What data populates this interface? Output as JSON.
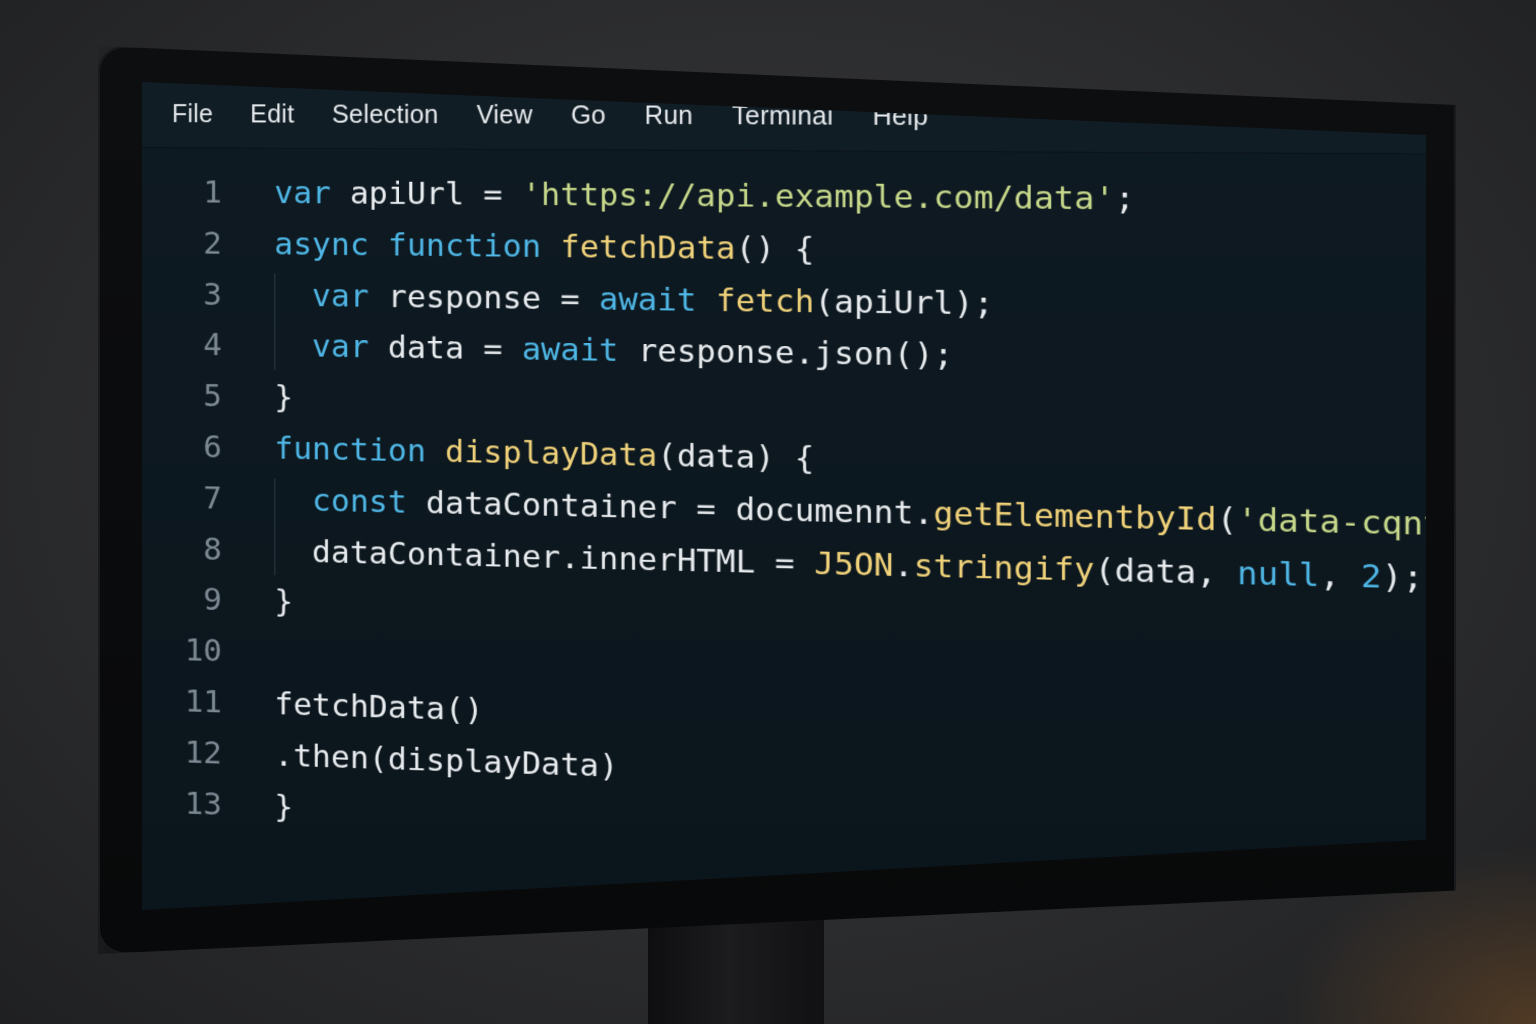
{
  "menu": {
    "items": [
      "File",
      "Edit",
      "Selection",
      "View",
      "Go",
      "Run",
      "Terminal",
      "Help"
    ]
  },
  "editor": {
    "line_numbers": [
      "1",
      "2",
      "3",
      "4",
      "5",
      "6",
      "7",
      "8",
      "9",
      "10",
      "11",
      "12",
      "13"
    ],
    "lines": [
      [
        {
          "t": "var",
          "c": "kw"
        },
        {
          "t": " apiUrl = ",
          "c": "pl"
        },
        {
          "t": "'https://api.example.com/data'",
          "c": "str"
        },
        {
          "t": ";",
          "c": "pl"
        }
      ],
      [
        {
          "t": "async",
          "c": "kw"
        },
        {
          "t": " ",
          "c": "pl"
        },
        {
          "t": "function",
          "c": "kw"
        },
        {
          "t": " ",
          "c": "pl"
        },
        {
          "t": "fetchData",
          "c": "fn"
        },
        {
          "t": "() {",
          "c": "pl"
        }
      ],
      [
        {
          "t": "  ",
          "c": "pl"
        },
        {
          "t": "var",
          "c": "kw"
        },
        {
          "t": " response = ",
          "c": "pl"
        },
        {
          "t": "await",
          "c": "kw"
        },
        {
          "t": " ",
          "c": "pl"
        },
        {
          "t": "fetch",
          "c": "fn"
        },
        {
          "t": "(apiUrl);",
          "c": "pl"
        }
      ],
      [
        {
          "t": "  ",
          "c": "pl"
        },
        {
          "t": "var",
          "c": "kw"
        },
        {
          "t": " data = ",
          "c": "pl"
        },
        {
          "t": "await",
          "c": "kw"
        },
        {
          "t": " response.json();",
          "c": "pl"
        }
      ],
      [
        {
          "t": "}",
          "c": "pl"
        }
      ],
      [
        {
          "t": "function",
          "c": "kw"
        },
        {
          "t": " ",
          "c": "pl"
        },
        {
          "t": "displayData",
          "c": "fn"
        },
        {
          "t": "(data) {",
          "c": "pl"
        }
      ],
      [
        {
          "t": "  ",
          "c": "pl"
        },
        {
          "t": "const",
          "c": "kw"
        },
        {
          "t": " dataContainer = documennt.",
          "c": "pl"
        },
        {
          "t": "getElementbyId",
          "c": "fn"
        },
        {
          "t": "(",
          "c": "pl"
        },
        {
          "t": "'data-cqntainer'",
          "c": "str"
        },
        {
          "t": ");",
          "c": "pl"
        }
      ],
      [
        {
          "t": "  dataContainer.innerHTML = ",
          "c": "pl"
        },
        {
          "t": "J5ON",
          "c": "fn"
        },
        {
          "t": ".",
          "c": "pl"
        },
        {
          "t": "stringify",
          "c": "fn"
        },
        {
          "t": "(data, ",
          "c": "pl"
        },
        {
          "t": "null",
          "c": "kw"
        },
        {
          "t": ", ",
          "c": "pl"
        },
        {
          "t": "2",
          "c": "num"
        },
        {
          "t": ");",
          "c": "pl"
        }
      ],
      [
        {
          "t": "}",
          "c": "pl"
        }
      ],
      [],
      [
        {
          "t": "fetchData()",
          "c": "pl"
        }
      ],
      [
        {
          "t": ".then(displayData)",
          "c": "pl"
        }
      ],
      [
        {
          "t": "}",
          "c": "pl"
        }
      ]
    ]
  },
  "colors": {
    "keyword": "#4fb7e6",
    "function": "#f0d27a",
    "string": "#c8d98b",
    "plain": "#e8ecef",
    "line_number": "#7d8a93",
    "background": "#0e1a22"
  }
}
